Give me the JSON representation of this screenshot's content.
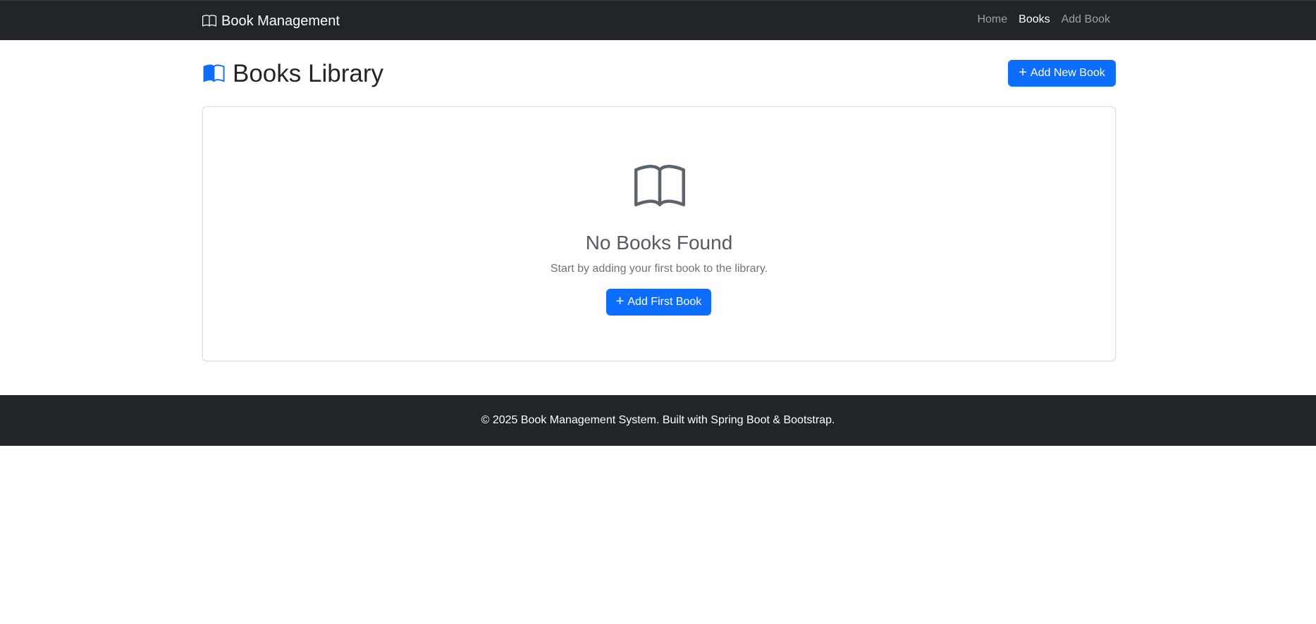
{
  "navbar": {
    "brand": "Book Management",
    "brand_icon": "book-icon",
    "links": [
      {
        "label": "Home",
        "active": false
      },
      {
        "label": "Books",
        "active": true
      },
      {
        "label": "Add Book",
        "active": false
      }
    ]
  },
  "header": {
    "title": "Books Library",
    "title_icon": "book-open-icon",
    "add_button": "Add New Book"
  },
  "empty_state": {
    "icon": "book-icon",
    "title": "No Books Found",
    "message": "Start by adding your first book to the library.",
    "button": "Add First Book"
  },
  "footer": {
    "text": "© 2025 Book Management System. Built with Spring Boot & Bootstrap."
  },
  "colors": {
    "navbar_bg": "#212529",
    "primary": "#0d6efd",
    "muted": "#6c757d"
  }
}
